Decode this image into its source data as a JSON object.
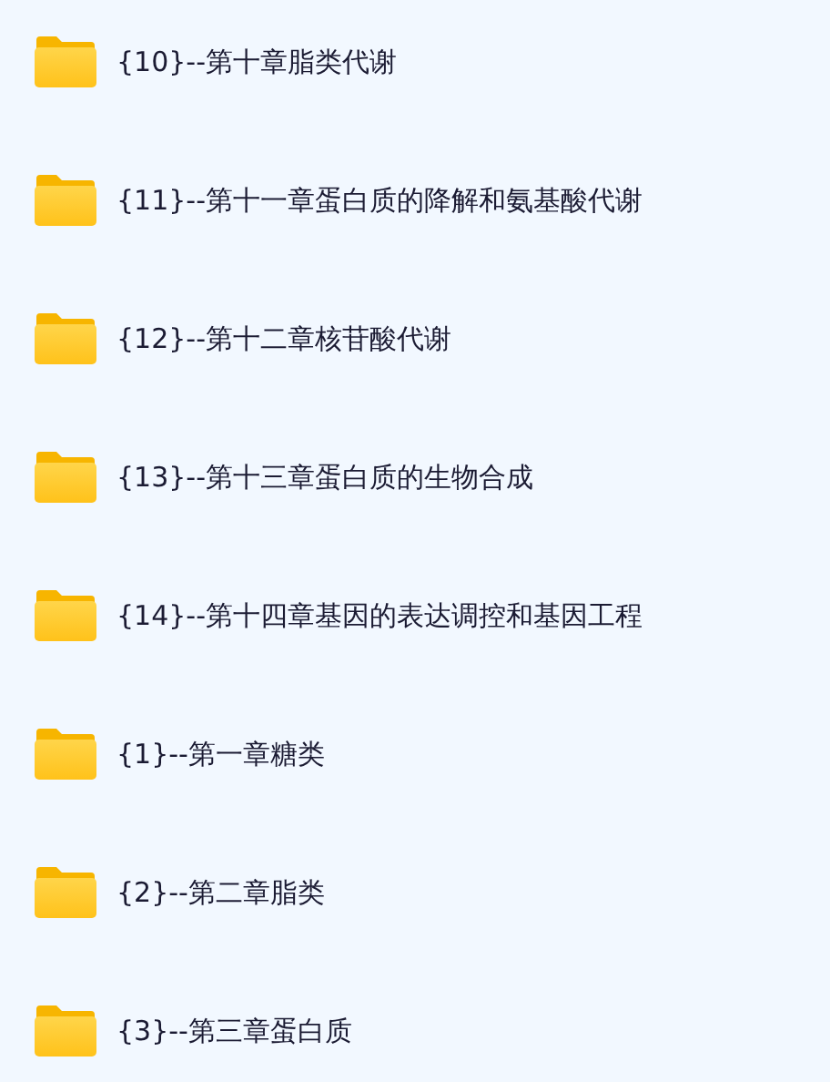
{
  "folders": [
    {
      "name": "{10}--第十章脂类代谢"
    },
    {
      "name": "{11}--第十一章蛋白质的降解和氨基酸代谢"
    },
    {
      "name": "{12}--第十二章核苷酸代谢"
    },
    {
      "name": "{13}--第十三章蛋白质的生物合成"
    },
    {
      "name": "{14}--第十四章基因的表达调控和基因工程"
    },
    {
      "name": "{1}--第一章糖类"
    },
    {
      "name": "{2}--第二章脂类"
    },
    {
      "name": "{3}--第三章蛋白质"
    }
  ]
}
